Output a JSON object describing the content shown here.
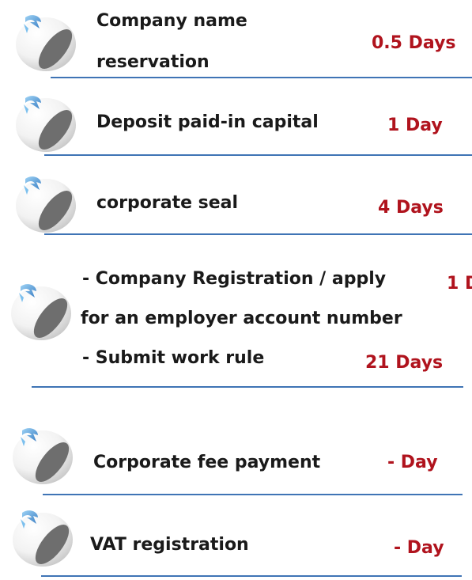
{
  "steps": [
    {
      "label_lines": [
        "Company name",
        "reservation"
      ],
      "duration": "0.5 Days"
    },
    {
      "label_lines": [
        "Deposit paid-in capital"
      ],
      "duration": "1 Day"
    },
    {
      "label_lines": [
        "corporate seal"
      ],
      "duration": "4 Days"
    },
    {
      "label_lines": [
        "- Company Registration / apply",
        "for an employer account number",
        "- Submit work rule"
      ],
      "duration_top": "1 D",
      "duration": "21 Days"
    },
    {
      "label_lines": [
        "Corporate fee payment"
      ],
      "duration": "- Day"
    },
    {
      "label_lines": [
        "VAT registration"
      ],
      "duration": "- Day"
    }
  ],
  "icon": "step-bullet-icon",
  "colors": {
    "duration": "#b0131d",
    "rule": "#3f74b5",
    "text": "#1a1a1a"
  }
}
